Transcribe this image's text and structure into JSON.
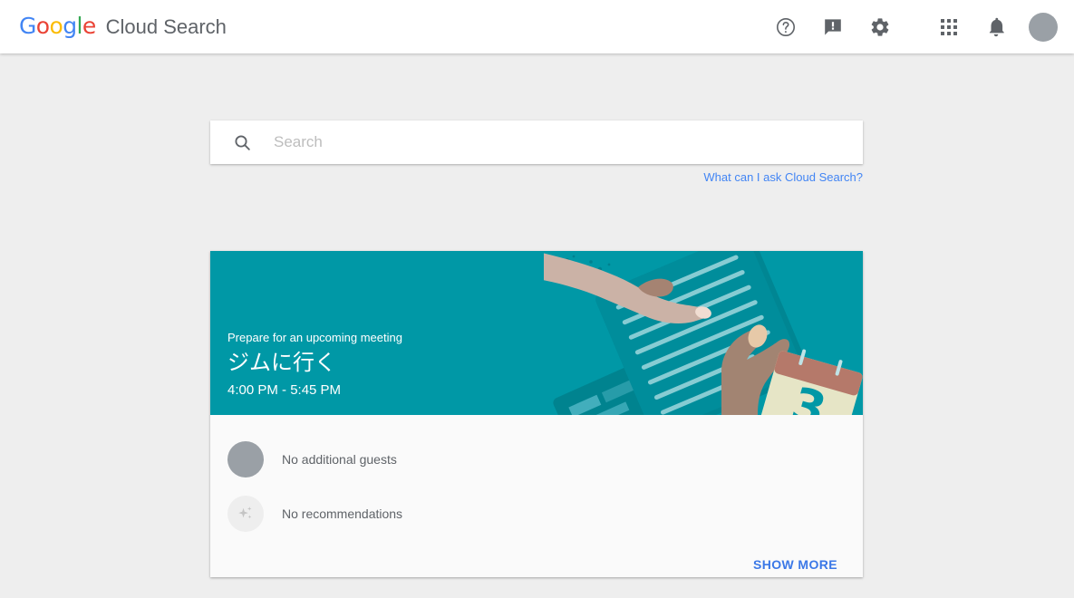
{
  "header": {
    "logo": {
      "letters": [
        {
          "char": "G",
          "color": "#4285f4"
        },
        {
          "char": "o",
          "color": "#ea4335"
        },
        {
          "char": "o",
          "color": "#fbbc05"
        },
        {
          "char": "g",
          "color": "#4285f4"
        },
        {
          "char": "l",
          "color": "#34a853"
        },
        {
          "char": "e",
          "color": "#ea4335"
        }
      ],
      "product": "Cloud Search"
    },
    "icons": [
      {
        "name": "help-icon",
        "title": "Help"
      },
      {
        "name": "feedback-icon",
        "title": "Send feedback"
      },
      {
        "name": "settings-gear-icon",
        "title": "Settings"
      },
      {
        "name": "apps-grid-icon",
        "title": "Google apps"
      },
      {
        "name": "notifications-bell-icon",
        "title": "Notifications"
      },
      {
        "name": "account-avatar",
        "title": "Google Account"
      }
    ]
  },
  "search": {
    "placeholder": "Search",
    "value": "",
    "icon": "search-icon"
  },
  "ask_link": {
    "label": "What can I ask Cloud Search?",
    "color": "#4285f4"
  },
  "card": {
    "banner": {
      "kicker": "Prepare for an upcoming meeting",
      "title": "ジムに行く",
      "time": "4:00 PM - 5:45 PM",
      "background_color": "#0098a6",
      "illustration": "hands-reviewing-document-with-calendar"
    },
    "rows": [
      {
        "icon": "guest-avatar-icon",
        "label": "No additional guests"
      },
      {
        "icon": "sparkle-recommendations-icon",
        "label": "No recommendations"
      }
    ],
    "footer": {
      "show_more_label": "SHOW MORE",
      "show_more_color": "#3b78e7"
    }
  },
  "theme": {
    "page_background": "#eeeeee",
    "header_background": "#ffffff",
    "card_background": "#fafafa",
    "accent_teal": "#0098a6",
    "muted_text": "#5f6368",
    "placeholder_text": "#bdbdbd"
  }
}
